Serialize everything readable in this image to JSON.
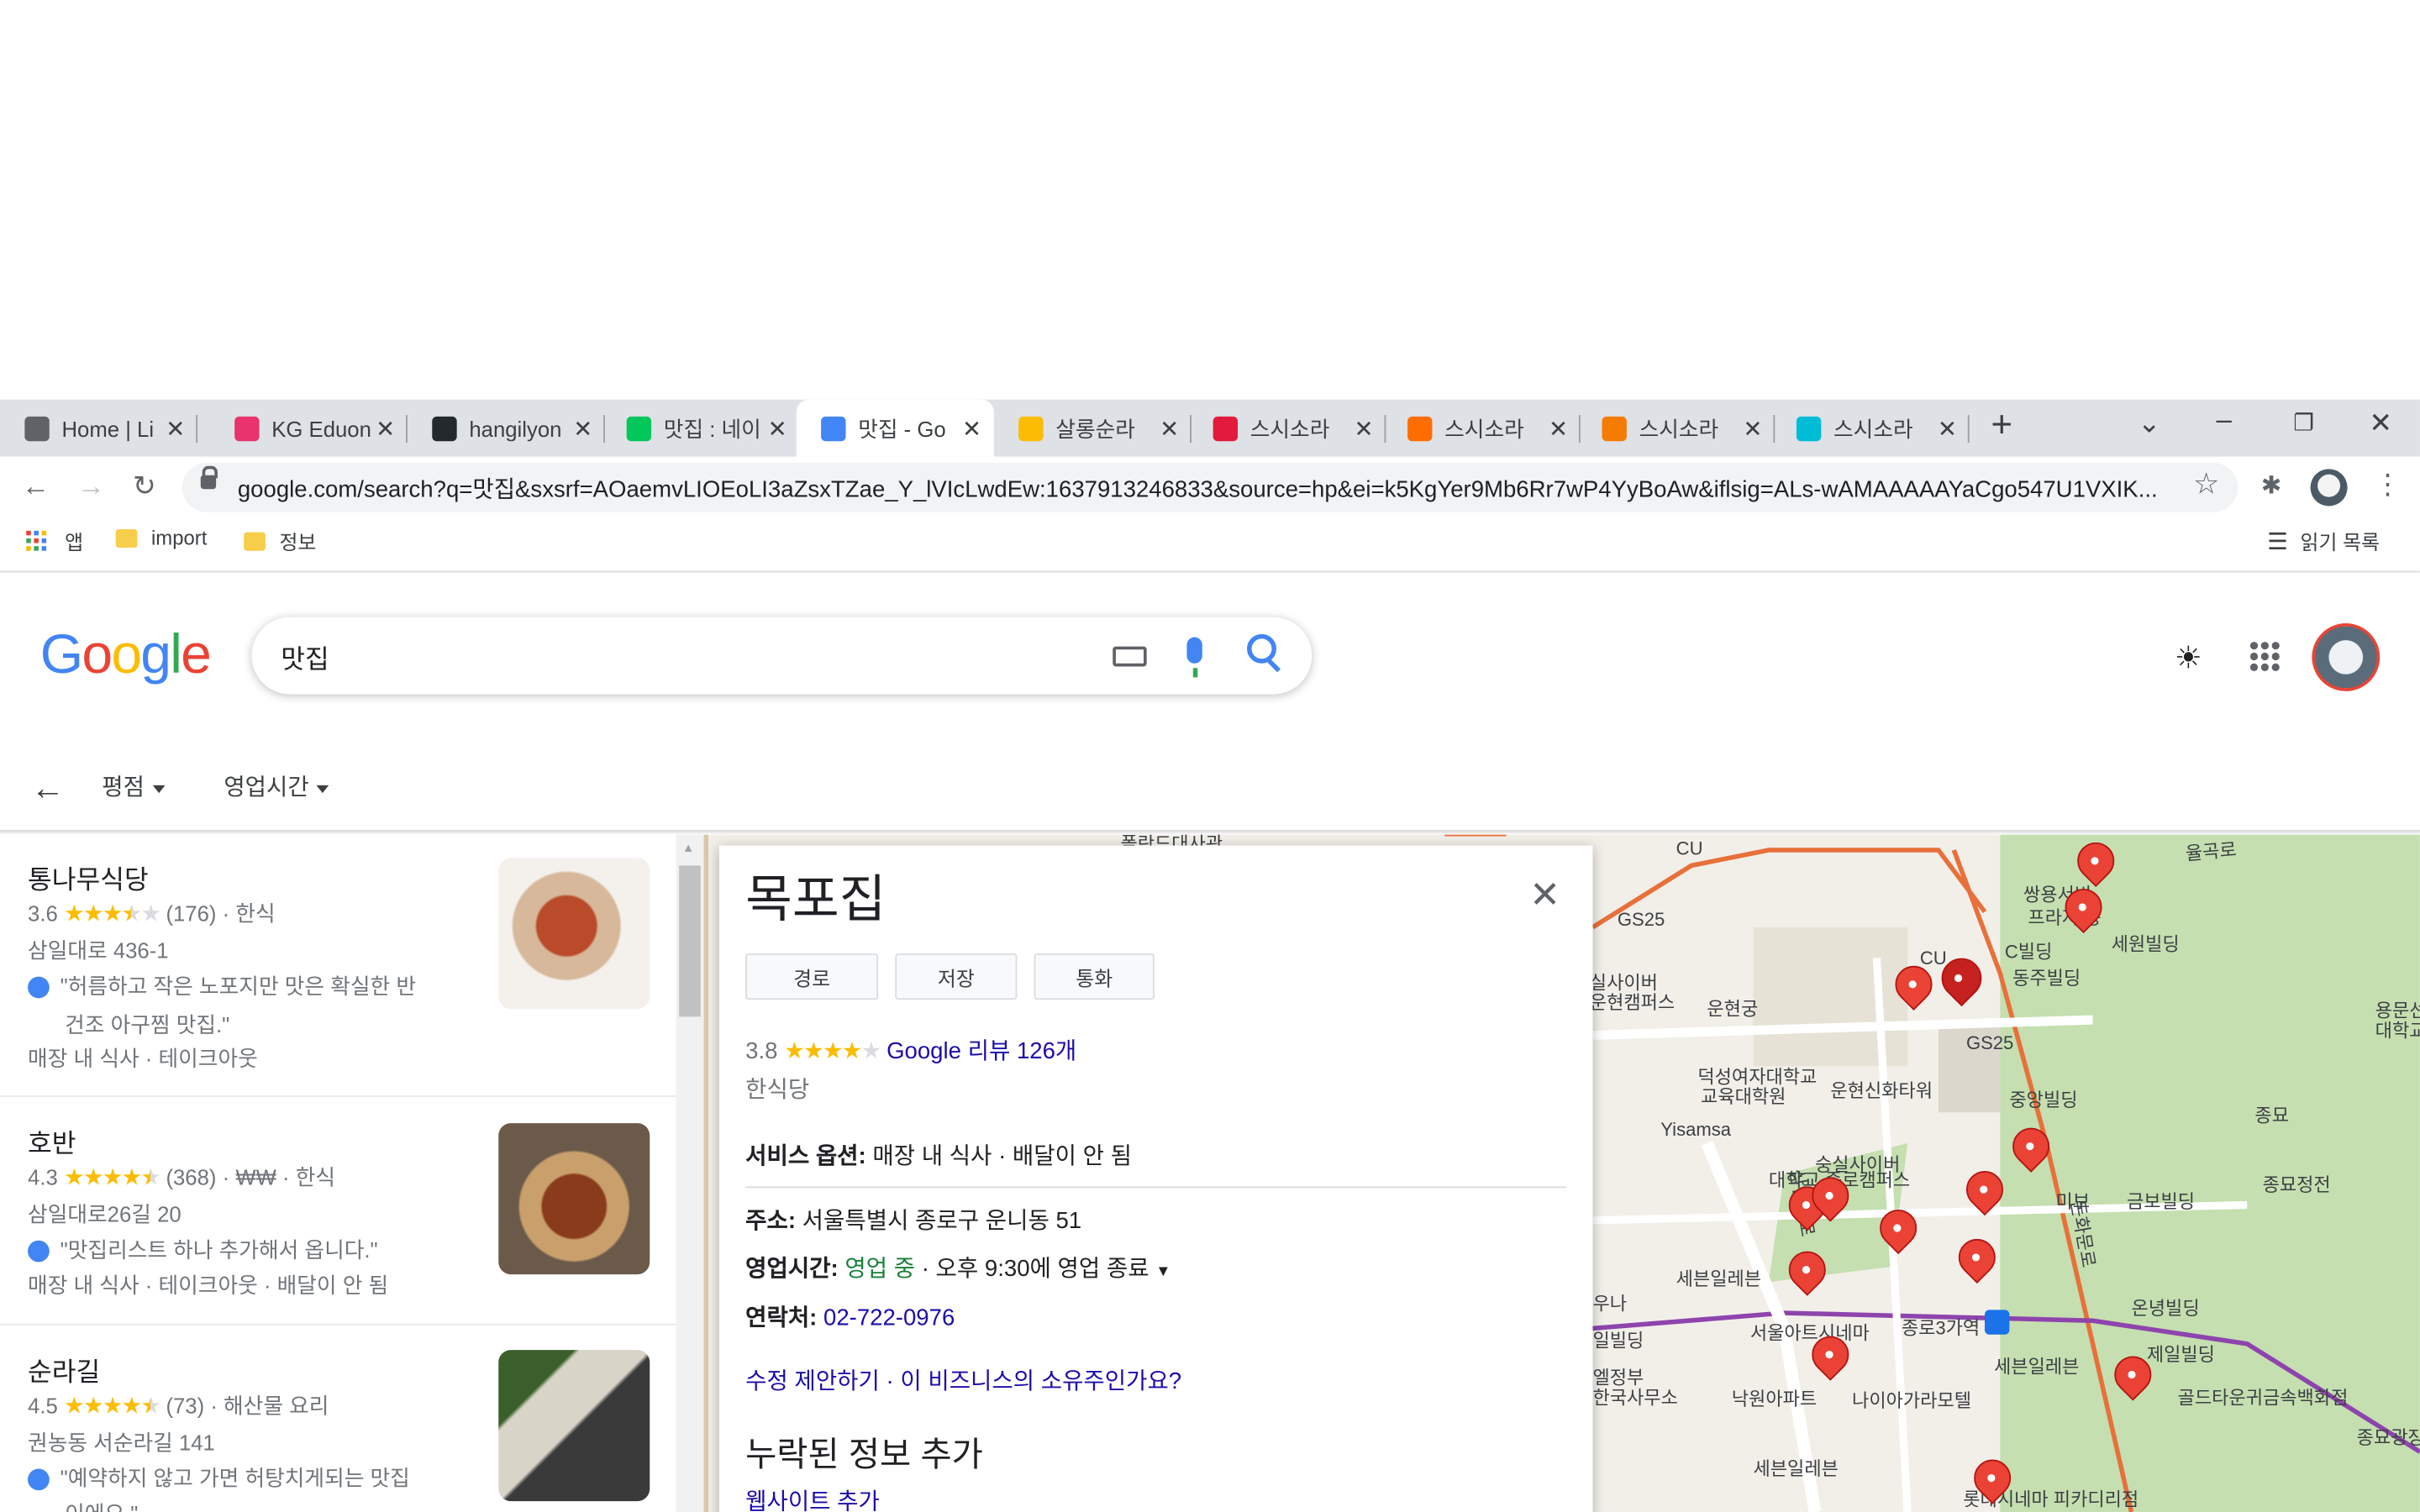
{
  "browser": {
    "tabs": [
      {
        "title": "Home | Li",
        "icon": "globe-icon",
        "color": "#5f6368"
      },
      {
        "title": "KG Eduon",
        "icon": "kg-eduone-icon",
        "color": "#e8336d"
      },
      {
        "title": "hangilyon",
        "icon": "github-icon",
        "color": "#24292e"
      },
      {
        "title": "맛집 : 네이",
        "icon": "naver-icon",
        "color": "#03c75a"
      },
      {
        "title": "맛집 - Go",
        "icon": "google-icon",
        "color": "#4285f4",
        "active": true
      },
      {
        "title": "살롱순라",
        "icon": "maps-pin-icon",
        "color": "#fbbc04"
      },
      {
        "title": "스시소라",
        "icon": "p-icon",
        "color": "#e21b3c"
      },
      {
        "title": "스시소라",
        "icon": "m-icon",
        "color": "#ff6d00"
      },
      {
        "title": "스시소라",
        "icon": "orange-circle-icon",
        "color": "#f57c00"
      },
      {
        "title": "스시소라",
        "icon": "d-icon",
        "color": "#00bcd4"
      }
    ],
    "address": "google.com/search?q=맛집&sxsrf=AOaemvLIOEoLI3aZsxTZae_Y_lVIcLwdEw:1637913246833&source=hp&ei=k5KgYer9Mb6Rr7wP4YyBoAw&iflsig=ALs-wAMAAAAAYaCgo547U1VXIK...",
    "bookmarks": {
      "apps": "앱",
      "folder1": "import",
      "folder2": "정보",
      "reading_list": "읽기 목록"
    }
  },
  "google": {
    "logo": "Google",
    "query": "맛집",
    "filters": [
      "평점",
      "영업시간"
    ]
  },
  "results": [
    {
      "name": "통나무식당",
      "rating": "3.6",
      "stars": 3.6,
      "meta": "(176) · 한식",
      "address": "삼일대로 436-1",
      "review_line1": "\"허름하고 작은 노포지만 맛은 확실한 반",
      "review_line2": "건조 아구찜 맛집.\"",
      "services": "매장 내 식사 · 테이크아웃"
    },
    {
      "name": "호반",
      "rating": "4.3",
      "stars": 4.3,
      "meta": "(368) · ₩₩ · 한식",
      "address": "삼일대로26길 20",
      "review_line1": "\"맛집리스트 하나 추가해서 옵니다.\"",
      "services": "매장 내 식사 · 테이크아웃 · 배달이 안 됨"
    },
    {
      "name": "순라길",
      "rating": "4.5",
      "stars": 4.5,
      "meta": "(73) · 해산물 요리",
      "address": "권농동 서순라길 141",
      "review_line1": "\"예약하지 않고 가면 허탕치게되는 맛집",
      "review_line2": "이에요.\""
    }
  ],
  "panel": {
    "title": "목포집",
    "buttons": [
      "경로",
      "저장",
      "통화"
    ],
    "rating": "3.8",
    "stars": 3.8,
    "reviews_link": "Google 리뷰 126개",
    "category": "한식당",
    "service_label": "서비스 옵션:",
    "service_value": "매장 내 식사 · 배달이 안 됨",
    "address_label": "주소:",
    "address_value": "서울특별시 종로구 운니동 51",
    "hours_label": "영업시간:",
    "hours_open": "영업 중",
    "hours_value": " · 오후 9:30에 영업 종료",
    "phone_label": "연락처:",
    "phone_value": "02-722-0976",
    "edit_link": "수정 제안하기 · 이 비즈니스의 소유주인가요?",
    "missing_title": "누락된 정보 추가",
    "website_link": "웹사이트 추가"
  },
  "map": {
    "labels": [
      "폴란드대사관",
      "CU",
      "율곡로",
      "쌍용서비",
      "프라자 종",
      "세원빌딩",
      "C빌딩",
      "동주빌딩",
      "CU",
      "GS25",
      "실사이버",
      "운현캠퍼스",
      "운현궁",
      "GS25",
      "덕성여자대학교",
      "교육대학원",
      "운현신화타워",
      "중앙빌딩",
      "Yisamsa",
      "숭실사이버",
      "대학교 종로캠퍼스",
      "미보",
      "금보빌딩",
      "종묘",
      "종묘정전",
      "세븐일레븐",
      "서울아트시네마",
      "종로3가역",
      "세븐일레븐",
      "온녕빌딩",
      "제일빌딩",
      "골드타운귀금속백화점",
      "낙원아파트",
      "나이아가라모텔",
      "세븐일레븐",
      "롯데시네마 피카디리점",
      "용문선",
      "대학교",
      "종묘광장",
      "우나",
      "일빌딩",
      "엘정부",
      "한국사무소",
      "삼일대로",
      "돈화문로"
    ]
  }
}
